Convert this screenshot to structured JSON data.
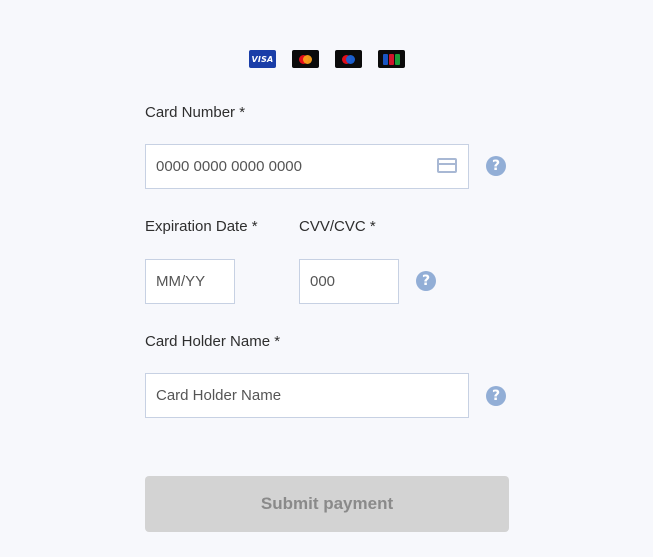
{
  "card_logos": [
    {
      "name": "visa",
      "text": "VISA",
      "color": "#1a3ea8"
    },
    {
      "name": "mastercard",
      "color": "#0b0b0b"
    },
    {
      "name": "maestro",
      "color": "#0b0b0b"
    },
    {
      "name": "jcb",
      "color": "#0b0b0b"
    }
  ],
  "card_number": {
    "label": "Card Number *",
    "placeholder": "0000 0000 0000 0000",
    "icon": "credit-card-icon"
  },
  "expiration": {
    "label": "Expiration Date *",
    "placeholder": "MM/YY"
  },
  "cvv": {
    "label": "CVV/CVC *",
    "placeholder": "000"
  },
  "holder": {
    "label": "Card Holder Name *",
    "placeholder": "Card Holder Name"
  },
  "help_icon": "?",
  "submit": {
    "label": "Submit payment",
    "state": "disabled"
  },
  "colors": {
    "background": "#f7f8fc",
    "input_border": "#c7d1e3",
    "help_icon": "#92aed6",
    "submit_disabled_bg": "#d3d3d3",
    "submit_disabled_text": "#8a8a8a"
  }
}
